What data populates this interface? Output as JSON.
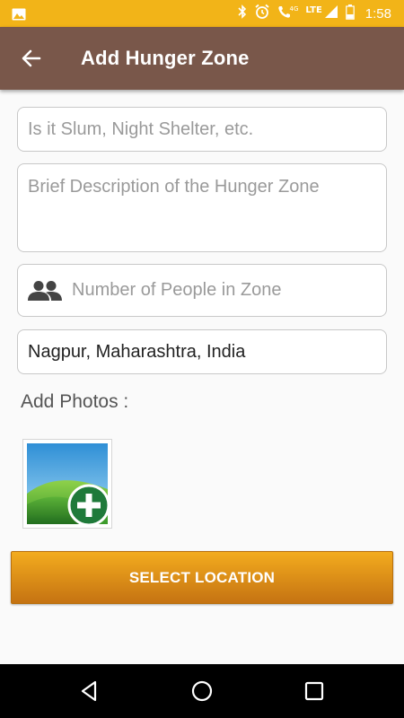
{
  "status_bar": {
    "time": "1:58",
    "network_label": "LTE",
    "data_label": "4G",
    "icons": [
      "image-icon",
      "bluetooth-icon",
      "alarm-icon",
      "wifi-call-icon",
      "signal-icon",
      "battery-icon"
    ]
  },
  "app_bar": {
    "title": "Add Hunger Zone",
    "back_icon": "arrow-back-icon"
  },
  "form": {
    "zone_type": {
      "value": "",
      "placeholder": "Is it Slum, Night Shelter, etc."
    },
    "description": {
      "value": "",
      "placeholder": "Brief Description of the Hunger Zone"
    },
    "people_count": {
      "value": "",
      "placeholder": "Number of People in Zone",
      "icon": "people-icon"
    },
    "location": {
      "value": "Nagpur, Maharashtra, India",
      "placeholder": ""
    },
    "photos_label": "Add Photos :",
    "add_photo_icon": "add-photo-icon"
  },
  "select_location_button": "SELECT LOCATION",
  "nav_bar": {
    "icons": [
      "back-triangle-icon",
      "home-circle-icon",
      "recents-square-icon"
    ]
  },
  "colors": {
    "status_bar": "#f2b418",
    "app_bar": "#79574a",
    "button_top": "#f3ac1e",
    "button_bottom": "#c57312",
    "background": "#fafafa"
  }
}
